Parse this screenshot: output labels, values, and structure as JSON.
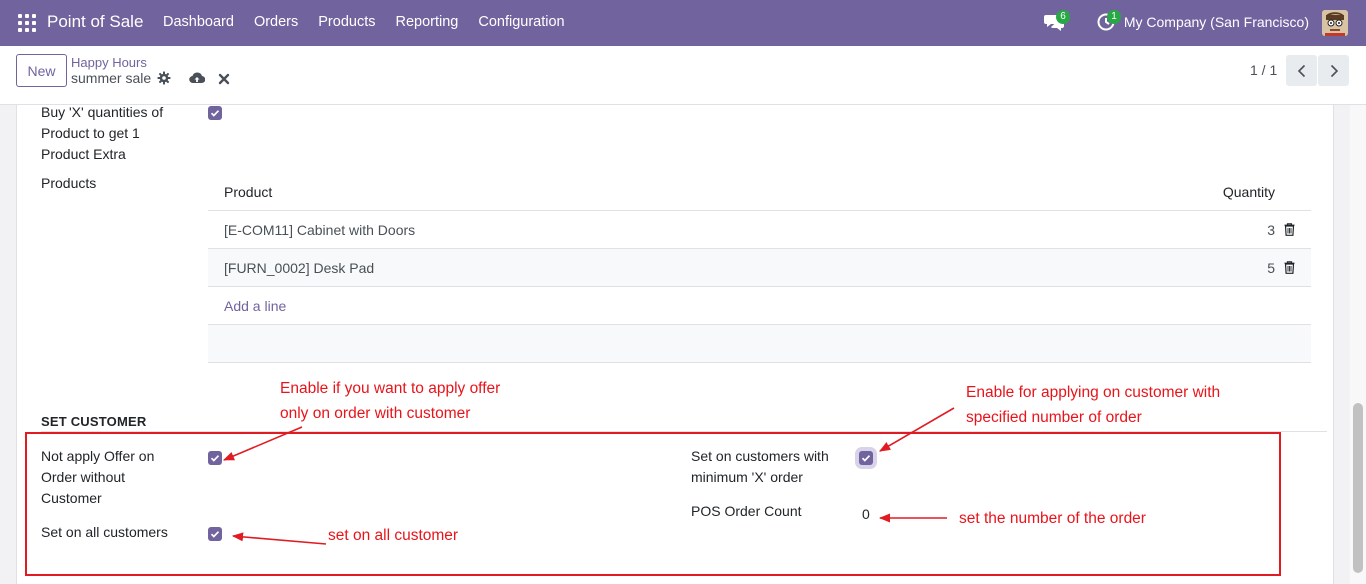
{
  "navbar": {
    "app_name": "Point of Sale",
    "menu": [
      "Dashboard",
      "Orders",
      "Products",
      "Reporting",
      "Configuration"
    ],
    "messages_count": "6",
    "activities_count": "1",
    "company": "My Company (San Francisco)",
    "accent": "#71639e"
  },
  "control_panel": {
    "new_label": "New",
    "breadcrumb_parent": "Happy Hours",
    "breadcrumb_current": "summer sale",
    "pager": "1 / 1"
  },
  "form": {
    "buy_x_label_lines": [
      "Buy 'X' quantities of",
      "Product to get 1",
      "Product Extra"
    ],
    "buy_x_checked": true,
    "products_label": "Products",
    "table": {
      "headers": [
        "Product",
        "Quantity"
      ],
      "rows": [
        {
          "product": "[E-COM11] Cabinet with Doors",
          "quantity": "3"
        },
        {
          "product": "[FURN_0002] Desk Pad",
          "quantity": "5"
        }
      ],
      "add_line": "Add a line"
    },
    "section_title": "SET CUSTOMER",
    "not_apply_label_lines": [
      "Not apply Offer on",
      "Order without",
      "Customer"
    ],
    "not_apply_checked": true,
    "all_customers_label": "Set on all customers",
    "all_customers_checked": true,
    "min_order_label_lines": [
      "Set on customers with",
      "minimum 'X' order"
    ],
    "min_order_checked": true,
    "pos_order_count_label": "POS Order Count",
    "pos_order_count_value": "0"
  },
  "annotations": {
    "note_customer_lines": [
      "Enable if you want to apply offer",
      "only on order with customer"
    ],
    "note_specified_lines": [
      "Enable for applying on customer with",
      "specified number of order"
    ],
    "note_all_customer": "set on all customer",
    "note_number": "set the number of the order",
    "color": "#e8141b"
  }
}
